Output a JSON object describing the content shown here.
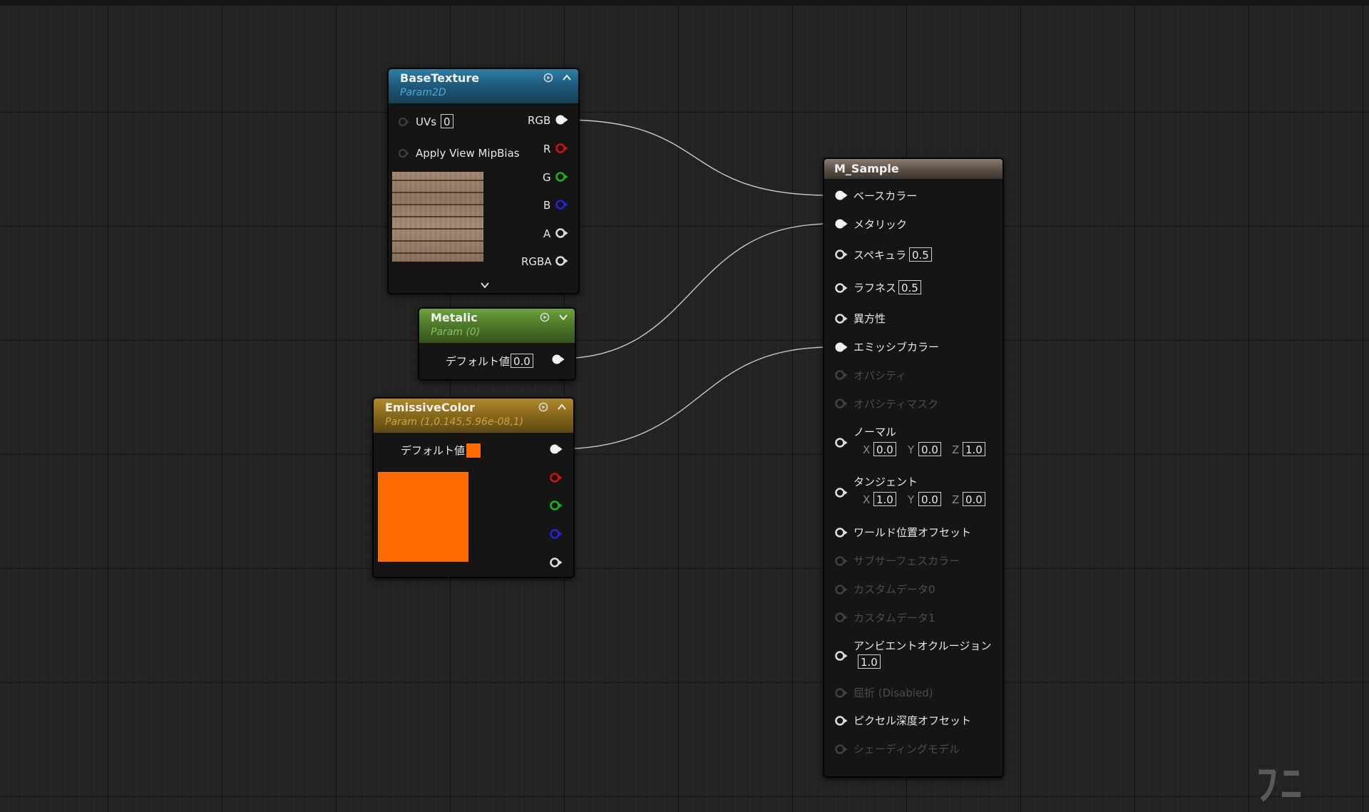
{
  "colors": {
    "base_header": "#1e5b7c",
    "metal_header": "#4f7b2a",
    "emissive_header": "#8c6a1c",
    "sample_header": "#5e5248",
    "pin_red": "#d21010",
    "pin_green": "#19b419",
    "pin_blue": "#2424dc",
    "emissive_swatch": "#ff6d00"
  },
  "base_texture": {
    "title": "BaseTexture",
    "subtitle": "Param2D",
    "uvs_label": "UVs",
    "uvs_value": "0",
    "mipbias_label": "Apply View MipBias",
    "outputs": {
      "rgb": "RGB",
      "r": "R",
      "g": "G",
      "b": "B",
      "a": "A",
      "rgba": "RGBA"
    },
    "thumbnail_icon": "wood-texture-thumbnail"
  },
  "metalic": {
    "title": "Metalic",
    "subtitle": "Param (0)",
    "default_label": "デフォルト値",
    "default_value": "0.0"
  },
  "emissive": {
    "title": "EmissiveColor",
    "subtitle": "Param (1,0.145,5.96e-08,1)",
    "default_label": "デフォルト値"
  },
  "material": {
    "title": "M_Sample",
    "pins": {
      "base_color": "ベースカラー",
      "metallic": "メタリック",
      "specular": "スペキュラ",
      "specular_value": "0.5",
      "roughness": "ラフネス",
      "roughness_value": "0.5",
      "anisotropy": "異方性",
      "emissive": "エミッシブカラー",
      "opacity": "オパシティ",
      "opacity_mask": "オパシティマスク",
      "normal": "ノーマル",
      "normal_x": "0.0",
      "normal_y": "0.0",
      "normal_z": "1.0",
      "tangent": "タンジェント",
      "tangent_x": "1.0",
      "tangent_y": "0.0",
      "tangent_z": "0.0",
      "axis_x": "X",
      "axis_y": "Y",
      "axis_z": "Z",
      "wpo": "ワールド位置オフセット",
      "subsurface": "サブサーフェスカラー",
      "custom0": "カスタムデータ0",
      "custom1": "カスタムデータ1",
      "ao": "アンビエントオクルージョン",
      "ao_value": "1.0",
      "refraction": "屈折 (Disabled)",
      "pdo": "ピクセル深度オフセット",
      "shading_model": "シェーディングモデル"
    }
  },
  "logo_text": "ﾌﾆ"
}
